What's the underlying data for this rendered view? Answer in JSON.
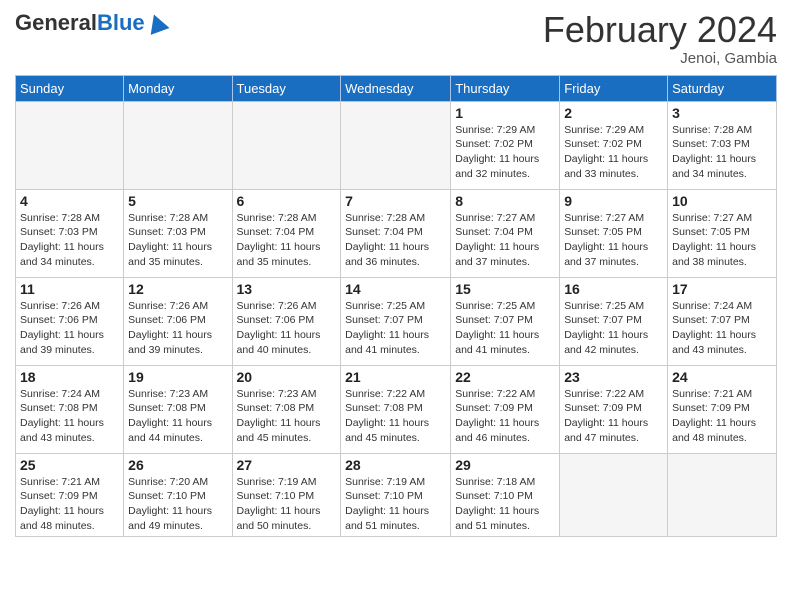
{
  "header": {
    "logo_general": "General",
    "logo_blue": "Blue",
    "month_title": "February 2024",
    "location": "Jenoi, Gambia"
  },
  "days_of_week": [
    "Sunday",
    "Monday",
    "Tuesday",
    "Wednesday",
    "Thursday",
    "Friday",
    "Saturday"
  ],
  "weeks": [
    [
      {
        "day": "",
        "info": ""
      },
      {
        "day": "",
        "info": ""
      },
      {
        "day": "",
        "info": ""
      },
      {
        "day": "",
        "info": ""
      },
      {
        "day": "1",
        "info": "Sunrise: 7:29 AM\nSunset: 7:02 PM\nDaylight: 11 hours and 32 minutes."
      },
      {
        "day": "2",
        "info": "Sunrise: 7:29 AM\nSunset: 7:02 PM\nDaylight: 11 hours and 33 minutes."
      },
      {
        "day": "3",
        "info": "Sunrise: 7:28 AM\nSunset: 7:03 PM\nDaylight: 11 hours and 34 minutes."
      }
    ],
    [
      {
        "day": "4",
        "info": "Sunrise: 7:28 AM\nSunset: 7:03 PM\nDaylight: 11 hours and 34 minutes."
      },
      {
        "day": "5",
        "info": "Sunrise: 7:28 AM\nSunset: 7:03 PM\nDaylight: 11 hours and 35 minutes."
      },
      {
        "day": "6",
        "info": "Sunrise: 7:28 AM\nSunset: 7:04 PM\nDaylight: 11 hours and 35 minutes."
      },
      {
        "day": "7",
        "info": "Sunrise: 7:28 AM\nSunset: 7:04 PM\nDaylight: 11 hours and 36 minutes."
      },
      {
        "day": "8",
        "info": "Sunrise: 7:27 AM\nSunset: 7:04 PM\nDaylight: 11 hours and 37 minutes."
      },
      {
        "day": "9",
        "info": "Sunrise: 7:27 AM\nSunset: 7:05 PM\nDaylight: 11 hours and 37 minutes."
      },
      {
        "day": "10",
        "info": "Sunrise: 7:27 AM\nSunset: 7:05 PM\nDaylight: 11 hours and 38 minutes."
      }
    ],
    [
      {
        "day": "11",
        "info": "Sunrise: 7:26 AM\nSunset: 7:06 PM\nDaylight: 11 hours and 39 minutes."
      },
      {
        "day": "12",
        "info": "Sunrise: 7:26 AM\nSunset: 7:06 PM\nDaylight: 11 hours and 39 minutes."
      },
      {
        "day": "13",
        "info": "Sunrise: 7:26 AM\nSunset: 7:06 PM\nDaylight: 11 hours and 40 minutes."
      },
      {
        "day": "14",
        "info": "Sunrise: 7:25 AM\nSunset: 7:07 PM\nDaylight: 11 hours and 41 minutes."
      },
      {
        "day": "15",
        "info": "Sunrise: 7:25 AM\nSunset: 7:07 PM\nDaylight: 11 hours and 41 minutes."
      },
      {
        "day": "16",
        "info": "Sunrise: 7:25 AM\nSunset: 7:07 PM\nDaylight: 11 hours and 42 minutes."
      },
      {
        "day": "17",
        "info": "Sunrise: 7:24 AM\nSunset: 7:07 PM\nDaylight: 11 hours and 43 minutes."
      }
    ],
    [
      {
        "day": "18",
        "info": "Sunrise: 7:24 AM\nSunset: 7:08 PM\nDaylight: 11 hours and 43 minutes."
      },
      {
        "day": "19",
        "info": "Sunrise: 7:23 AM\nSunset: 7:08 PM\nDaylight: 11 hours and 44 minutes."
      },
      {
        "day": "20",
        "info": "Sunrise: 7:23 AM\nSunset: 7:08 PM\nDaylight: 11 hours and 45 minutes."
      },
      {
        "day": "21",
        "info": "Sunrise: 7:22 AM\nSunset: 7:08 PM\nDaylight: 11 hours and 45 minutes."
      },
      {
        "day": "22",
        "info": "Sunrise: 7:22 AM\nSunset: 7:09 PM\nDaylight: 11 hours and 46 minutes."
      },
      {
        "day": "23",
        "info": "Sunrise: 7:22 AM\nSunset: 7:09 PM\nDaylight: 11 hours and 47 minutes."
      },
      {
        "day": "24",
        "info": "Sunrise: 7:21 AM\nSunset: 7:09 PM\nDaylight: 11 hours and 48 minutes."
      }
    ],
    [
      {
        "day": "25",
        "info": "Sunrise: 7:21 AM\nSunset: 7:09 PM\nDaylight: 11 hours and 48 minutes."
      },
      {
        "day": "26",
        "info": "Sunrise: 7:20 AM\nSunset: 7:10 PM\nDaylight: 11 hours and 49 minutes."
      },
      {
        "day": "27",
        "info": "Sunrise: 7:19 AM\nSunset: 7:10 PM\nDaylight: 11 hours and 50 minutes."
      },
      {
        "day": "28",
        "info": "Sunrise: 7:19 AM\nSunset: 7:10 PM\nDaylight: 11 hours and 51 minutes."
      },
      {
        "day": "29",
        "info": "Sunrise: 7:18 AM\nSunset: 7:10 PM\nDaylight: 11 hours and 51 minutes."
      },
      {
        "day": "",
        "info": ""
      },
      {
        "day": "",
        "info": ""
      }
    ]
  ]
}
